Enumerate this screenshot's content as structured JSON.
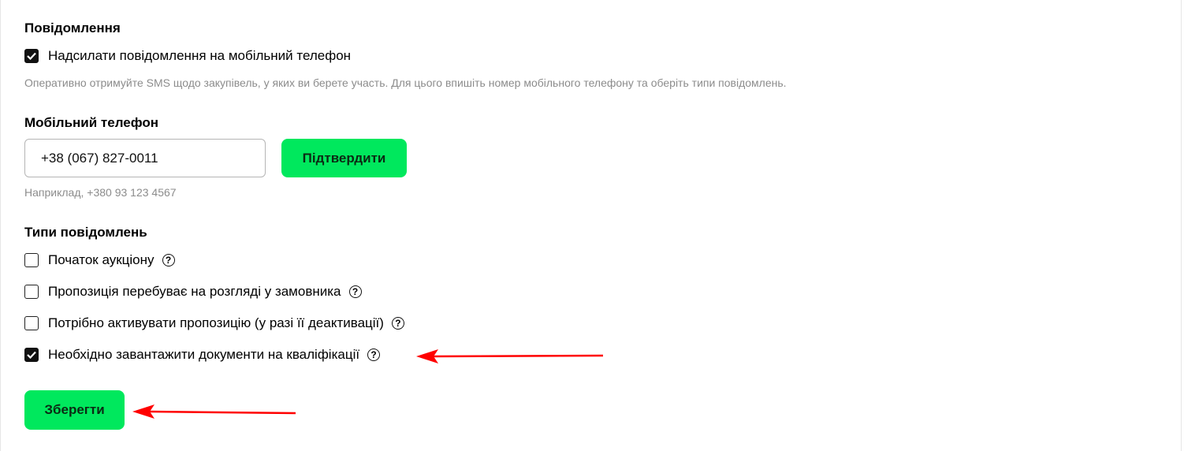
{
  "notifications": {
    "heading": "Повідомлення",
    "send_sms_label": "Надсилати повідомлення на мобільний телефон",
    "send_sms_checked": true,
    "description": "Оперативно отримуйте SMS щодо закупівель, у яких ви берете участь. Для цього впишіть номер мобільного телефону та оберіть типи повідомлень."
  },
  "phone": {
    "heading": "Мобільний телефон",
    "value": "+38 (067) 827-0011",
    "confirm_label": "Підтвердити",
    "example": "Наприклад, +380 93 123 4567"
  },
  "types": {
    "heading": "Типи повідомлень",
    "items": [
      {
        "label": "Початок аукціону",
        "checked": false
      },
      {
        "label": "Пропозиція перебуває на розгляді у замовника",
        "checked": false
      },
      {
        "label": "Потрібно активувати пропозицію (у разі її деактивації)",
        "checked": false
      },
      {
        "label": "Необхідно завантажити документи на кваліфікації",
        "checked": true
      }
    ]
  },
  "save_label": "Зберегти",
  "colors": {
    "accent_green": "#00e85d",
    "annotation_arrow": "#ff0000"
  },
  "icons": {
    "help": "question-circle-icon",
    "check": "checkmark-icon",
    "annotation": "red-arrow-icon"
  }
}
